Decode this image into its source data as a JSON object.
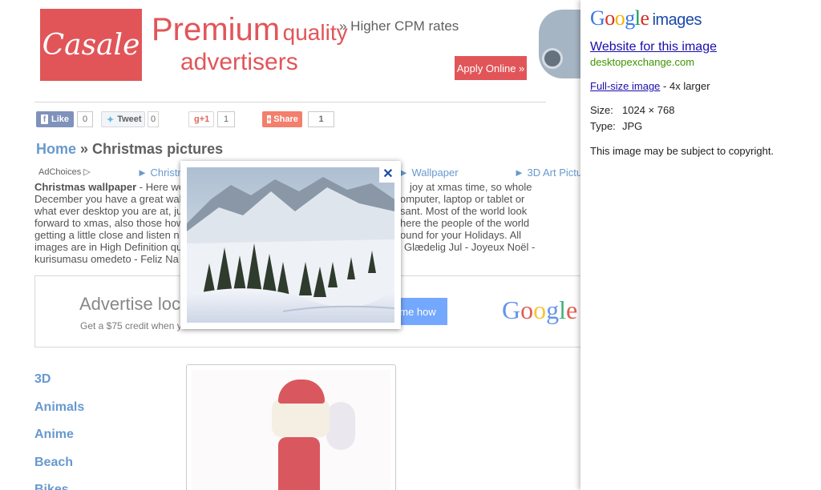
{
  "banner": {
    "brand": "Casale",
    "headline_big": "Premium",
    "headline_small": "quality",
    "headline_line2": "advertisers",
    "tagline": "» Higher CPM rates",
    "cta": "Apply Online »",
    "color": "#d9262b"
  },
  "share": {
    "facebook": {
      "label": "Like",
      "count": "0",
      "icon": "facebook-icon"
    },
    "twitter": {
      "label": "Tweet",
      "count": "0",
      "icon": "twitter-icon"
    },
    "gplus": {
      "label": "g+1",
      "count": "1"
    },
    "share": {
      "label": "Share",
      "count": "1",
      "icon": "plus-box-icon"
    }
  },
  "breadcrumb": {
    "home": "Home",
    "separator": " » ",
    "current": "Christmas pictures"
  },
  "adchoices": "AdChoices",
  "top_links": [
    "► Christmas",
    "► Wallpaper",
    "► 3D Art Pictu"
  ],
  "intro": {
    "lead": "Christmas wallpaper",
    "line1_left": " - Here we",
    "line1_right": "joy at xmas time, so whole",
    "line2_left": "December you have a great wal",
    "line2_right": "omputer, laptop or tablet or",
    "line3_left": "what ever desktop you are at, ju",
    "line3_right": "sant. Most of the world look",
    "line4_left": "forward to xmas, also those how",
    "line4_right": "here the people of the world",
    "line5_left": "getting a little close and listen n",
    "line5_right": "ound for your Holidays. All",
    "line6_left": "images are in High Definition qu",
    "line6_right": "Glædelig Jul - Joyeux Noël -",
    "line7_left": "kurisumasu omedeto - Feliz Na"
  },
  "adbox": {
    "headline": "Advertise loc",
    "sub": "Get a $75 credit when y",
    "cta": "me how",
    "logo": "Google"
  },
  "categories": [
    "3D",
    "Animals",
    "Anime",
    "Beach",
    "Bikes"
  ],
  "popup": {
    "close": "✕"
  },
  "panel": {
    "logo_google": "Google",
    "logo_images": "images",
    "website_link": "Website for this image",
    "domain": "desktopexchange.com",
    "fullsize_link": "Full-size image",
    "fullsize_suffix": " - 4x larger",
    "size_label": "Size:",
    "size_value": "1024 × 768",
    "type_label": "Type:",
    "type_value": "JPG",
    "copyright": "This image may be subject to copyright."
  }
}
